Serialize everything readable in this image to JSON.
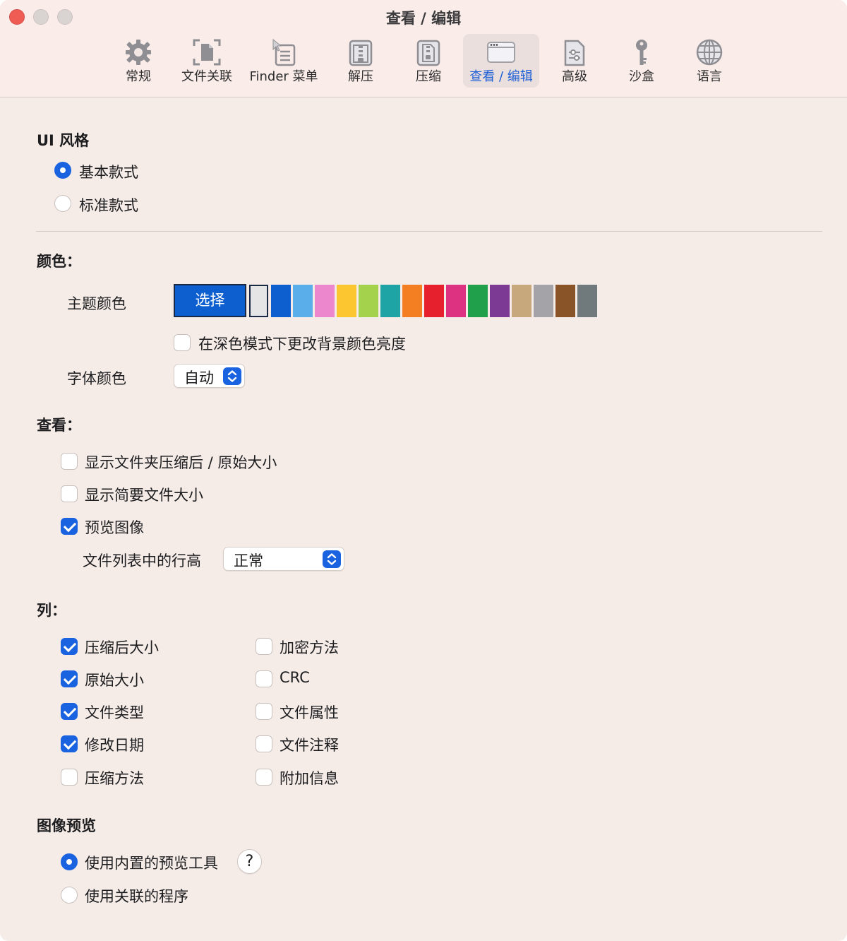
{
  "window": {
    "title": "查看 / 编辑"
  },
  "toolbar": {
    "items": [
      {
        "label": "常规",
        "icon": "gear-icon"
      },
      {
        "label": "文件关联",
        "icon": "file-association-icon"
      },
      {
        "label": "Finder 菜单",
        "icon": "finder-menu-icon"
      },
      {
        "label": "解压",
        "icon": "extract-archive-icon"
      },
      {
        "label": "压缩",
        "icon": "compress-archive-icon"
      },
      {
        "label": "查看 / 编辑",
        "icon": "window-icon",
        "active": true
      },
      {
        "label": "高级",
        "icon": "sliders-icon"
      },
      {
        "label": "沙盒",
        "icon": "key-icon"
      },
      {
        "label": "语言",
        "icon": "globe-icon"
      }
    ]
  },
  "ui_style": {
    "title": "UI 风格",
    "options": [
      {
        "label": "基本款式",
        "selected": true
      },
      {
        "label": "标准款式",
        "selected": false
      }
    ]
  },
  "colors": {
    "title": "颜色：",
    "theme_label": "主题颜色",
    "choose_label": "选择",
    "swatches": [
      "#e5e5e5",
      "#0d5fd0",
      "#5aaeea",
      "#ec86cd",
      "#fcc631",
      "#a4d24d",
      "#1fa4a6",
      "#f47e22",
      "#e6212d",
      "#dd3182",
      "#21a04b",
      "#7d3a94",
      "#c6a87c",
      "#a3a3a8",
      "#8a5429",
      "#707a7d"
    ],
    "dark_mode_label": "在深色模式下更改背景颜色亮度",
    "dark_mode_checked": false,
    "font_color_label": "字体颜色",
    "font_color_value": "自动"
  },
  "view": {
    "title": "查看：",
    "options": [
      {
        "label": "显示文件夹压缩后 / 原始大小",
        "checked": false
      },
      {
        "label": "显示简要文件大小",
        "checked": false
      },
      {
        "label": "预览图像",
        "checked": true
      }
    ],
    "row_height_label": "文件列表中的行高",
    "row_height_value": "正常"
  },
  "columns": {
    "title": "列：",
    "left": [
      {
        "label": "压缩后大小",
        "checked": true
      },
      {
        "label": "原始大小",
        "checked": true
      },
      {
        "label": "文件类型",
        "checked": true
      },
      {
        "label": "修改日期",
        "checked": true
      },
      {
        "label": "压缩方法",
        "checked": false
      }
    ],
    "right": [
      {
        "label": "加密方法",
        "checked": false
      },
      {
        "label": "CRC",
        "checked": false
      },
      {
        "label": "文件属性",
        "checked": false
      },
      {
        "label": "文件注释",
        "checked": false
      },
      {
        "label": "附加信息",
        "checked": false
      }
    ]
  },
  "image_preview": {
    "title": "图像预览",
    "options": [
      {
        "label": "使用内置的预览工具",
        "selected": true
      },
      {
        "label": "使用关联的程序",
        "selected": false
      }
    ],
    "help_label": "?"
  }
}
